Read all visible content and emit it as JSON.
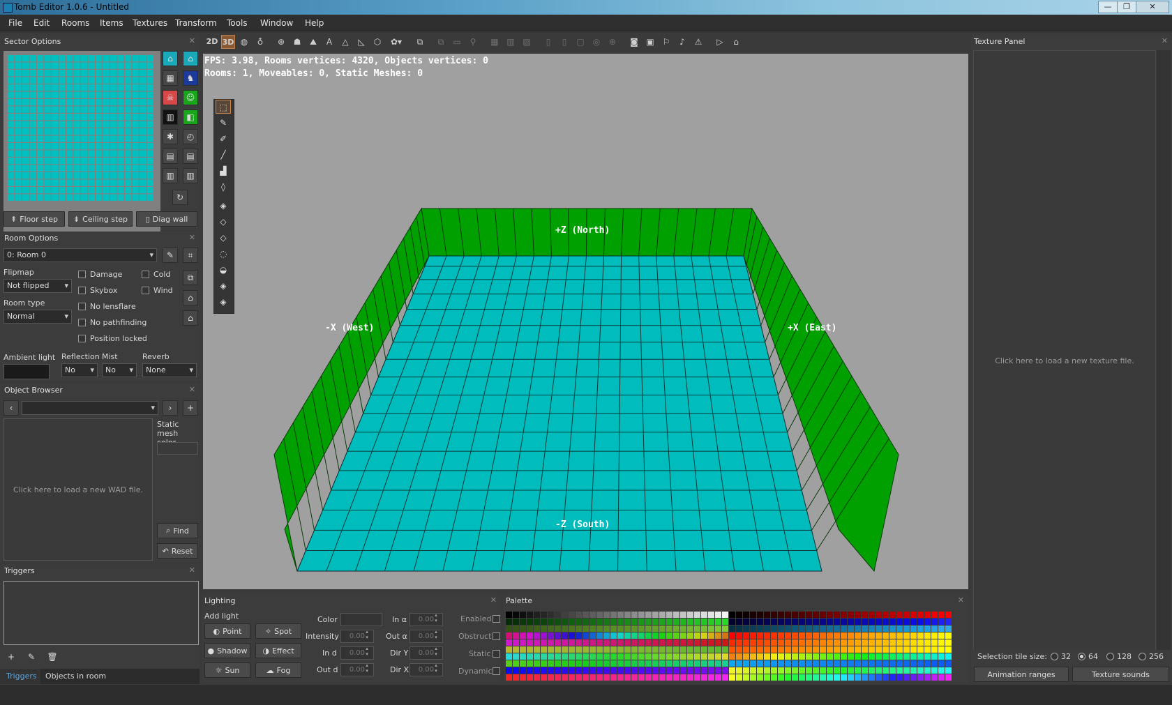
{
  "window": {
    "title": "Tomb Editor 1.0.6 - Untitled"
  },
  "menu": [
    "File",
    "Edit",
    "Rooms",
    "Items",
    "Textures",
    "Transform",
    "Tools",
    "Window",
    "Help"
  ],
  "sector_options": {
    "title": "Sector Options",
    "buttons": {
      "floor_step": "Floor step",
      "ceiling_step": "Ceiling step",
      "diag_wall": "Diag wall"
    },
    "grid_color": "#00c0c0"
  },
  "room_options": {
    "title": "Room Options",
    "room_selected": "0: Room 0",
    "flipmap_label": "Flipmap",
    "flipmap_value": "Not flipped",
    "room_type_label": "Room type",
    "room_type_value": "Normal",
    "checks": {
      "damage": "Damage",
      "cold": "Cold",
      "skybox": "Skybox",
      "wind": "Wind",
      "no_lensflare": "No lensflare",
      "no_pathfinding": "No pathfinding",
      "position_locked": "Position locked"
    },
    "ambient_label": "Ambient light",
    "reflection_label": "Reflection",
    "reflection_value": "No",
    "mist_label": "Mist",
    "mist_value": "No",
    "reverb_label": "Reverb",
    "reverb_value": "None"
  },
  "object_browser": {
    "title": "Object Browser",
    "placeholder": "Click here to load a new WAD file.",
    "static_mesh_label": "Static mesh color",
    "find": "Find",
    "reset": "Reset"
  },
  "triggers": {
    "title": "Triggers",
    "tabs": [
      "Triggers",
      "Objects in room"
    ]
  },
  "viewport": {
    "stats_line1": "FPS: 3.98, Rooms vertices: 4320, Objects vertices: 0",
    "stats_line2": "Rooms: 1, Moveables: 0, Static Meshes: 0",
    "mode_2d": "2D",
    "mode_3d": "3D",
    "north": "+Z (North)",
    "south": "-Z (South)",
    "west": "-X (West)",
    "east": "+X (East)",
    "floor_color": "#00bcbc",
    "wall_color": "#00a000"
  },
  "lighting": {
    "title": "Lighting",
    "add_light": "Add light",
    "buttons": {
      "point": "Point",
      "spot": "Spot",
      "shadow": "Shadow",
      "effect": "Effect",
      "sun": "Sun",
      "fog": "Fog"
    },
    "labels": {
      "color": "Color",
      "intensity": "Intensity",
      "in_d": "In d",
      "out_d": "Out d",
      "in_a": "In α",
      "out_a": "Out α",
      "dir_y": "Dir Y",
      "dir_x": "Dir X",
      "enabled": "Enabled",
      "obstruct": "Obstruct",
      "static": "Static",
      "dynamic": "Dynamic"
    },
    "zero": "0.00"
  },
  "palette": {
    "title": "Palette"
  },
  "texture_panel": {
    "title": "Texture Panel",
    "placeholder": "Click here to load a new texture file.",
    "tile_size_label": "Selection tile size:",
    "sizes": [
      "32",
      "64",
      "128",
      "256"
    ],
    "selected_size": "64",
    "animation_ranges": "Animation ranges",
    "texture_sounds": "Texture sounds"
  }
}
